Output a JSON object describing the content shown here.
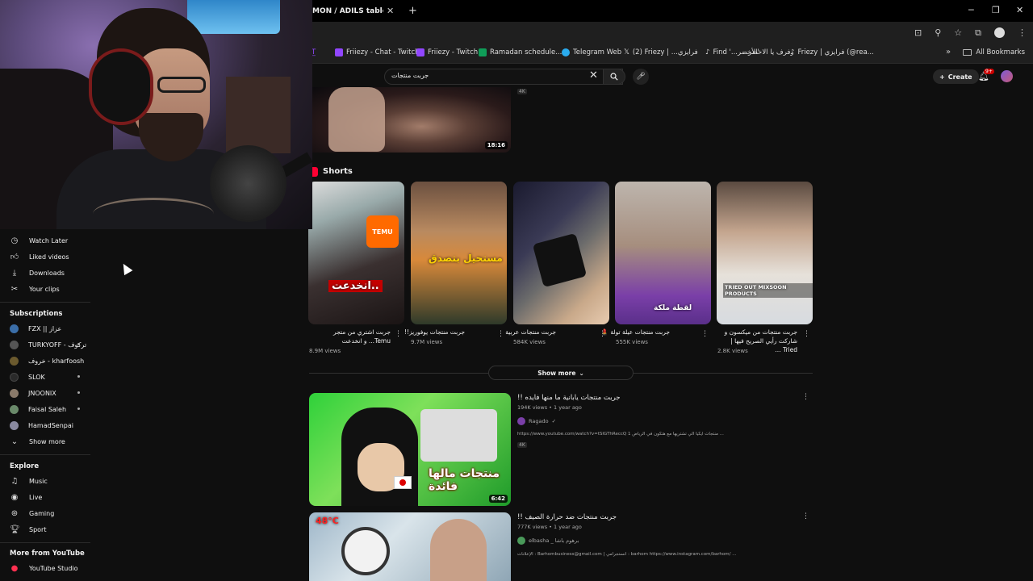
{
  "browser": {
    "tab_title": "MON / ADILS table, white",
    "new_tab": "+",
    "bookmarks": [
      {
        "label": "Friiezy - Chat - Twitch",
        "color": "#9146ff"
      },
      {
        "label": "Friiezy - Twitch",
        "color": "#9146ff"
      },
      {
        "label": "Ramadan schedule...",
        "color": "#0f9d58"
      },
      {
        "label": "Telegram Web",
        "color": "#2aabee"
      },
      {
        "label": "(2) Friezy | ...فرايزي",
        "color": "#ffffff"
      },
      {
        "label": "Find '...الأخضر'",
        "color": "#ffffff"
      },
      {
        "label": "رفرف يا الاخضر",
        "color": "#ffffff"
      },
      {
        "label": "Friezy | فرايزي (@rea...",
        "color": "#ffffff"
      }
    ],
    "all_bookmarks": "All Bookmarks"
  },
  "youtube": {
    "search_value": "جربت منتجات",
    "create_label": "Create",
    "notif_count": "9+"
  },
  "sidebar": {
    "items_top": [
      {
        "label": "Watch Later",
        "icon": "clock-icon"
      },
      {
        "label": "Liked videos",
        "icon": "thumb-up-icon"
      },
      {
        "label": "Downloads",
        "icon": "download-icon"
      },
      {
        "label": "Your clips",
        "icon": "scissors-icon"
      }
    ],
    "subscriptions_heading": "Subscriptions",
    "subscriptions": [
      {
        "label": "FZX || عزاز",
        "color": "#3b6ea8",
        "dot": false
      },
      {
        "label": "TURKYOFF - تركوف",
        "color": "#555555",
        "dot": true
      },
      {
        "label": "خروف - kharfoosh",
        "color": "#6b5a2e",
        "dot": false
      },
      {
        "label": "SLOK",
        "color": "#2a2a2a",
        "dot": true
      },
      {
        "label": "JNOONIX",
        "color": "#8a7a6a",
        "dot": true
      },
      {
        "label": "Faisal Saleh",
        "color": "#6a8a6a",
        "dot": true
      },
      {
        "label": "HamadSenpai",
        "color": "#8a8aa0",
        "dot": false
      }
    ],
    "show_more": "Show more",
    "explore_heading": "Explore",
    "explore": [
      {
        "label": "Music",
        "icon": "music-note-icon"
      },
      {
        "label": "Live",
        "icon": "live-icon"
      },
      {
        "label": "Gaming",
        "icon": "gamepad-icon"
      },
      {
        "label": "Sport",
        "icon": "trophy-icon"
      }
    ],
    "more_heading": "More from YouTube",
    "more": [
      {
        "label": "YouTube Studio",
        "icon": "studio-icon"
      }
    ]
  },
  "main": {
    "top_video": {
      "duration": "18:16",
      "badge": "4K"
    },
    "shorts_title": "Shorts",
    "shorts": [
      {
        "title": "جربت اشتري من متجر Temu... و انخدعت",
        "views": "8.9M views",
        "overlay": "انخدعت..",
        "badge": "TEMU"
      },
      {
        "title": "جربت منتجات يوفوريز!!",
        "views": "9.7M views",
        "overlay": "مستحيل بتصدق",
        "badge": ""
      },
      {
        "title": "جربت منتجات عربية",
        "views": "584K views",
        "overlay": "",
        "badge": ""
      },
      {
        "title": "جربت منتجات عيلة تولة 💄",
        "views": "555K views",
        "overlay": "لقطة ملكة",
        "badge": ""
      },
      {
        "title": "جربت منتجات من ميكسون و شاركت رأيي الصريح فيها | Tried ...",
        "views": "2.8K views",
        "overlay": "TRIED OUT MIXSOON PRODUCTS",
        "badge": ""
      }
    ],
    "show_more": "Show more",
    "videos": [
      {
        "title": "جربت منتجات يابانية ما منها فايده !!",
        "meta": "194K views • 1 year ago",
        "channel": "Ragado",
        "description": "https://www.youtube.com/watch?v=tSIGThReccQ 1 منتجات ايكيا الي تشتريها مع هتكون في الرياض ...",
        "badge": "4K",
        "duration": "6:42",
        "overlay": "منتجات مالها فائدة"
      },
      {
        "title": "جربت منتجات ضد حرارة الصيف !!",
        "meta": "777K views • 1 year ago",
        "channel": "elbasha _ برهوم باشا",
        "description": "الإعلانات : Barhombusiness@gmail.com | انستجرامي : barhom https://www.instagram.com/barhom/ ...",
        "overlay": "48°C"
      }
    ]
  }
}
